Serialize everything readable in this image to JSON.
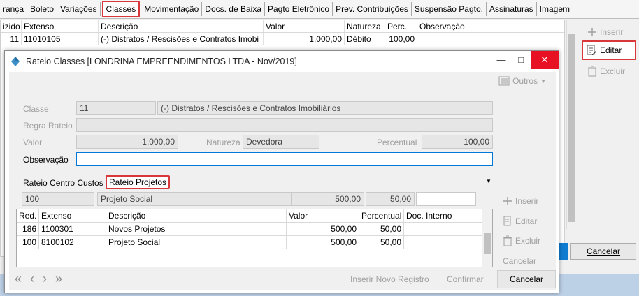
{
  "tabs": [
    "rança",
    "Boleto",
    "Variações",
    "Classes",
    "Movimentação",
    "Docs. de Baixa",
    "Pagto Eletrônico",
    "Prev. Contribuições",
    "Suspensão Pagto.",
    "Assinaturas",
    "Imagem"
  ],
  "main_grid": {
    "headers": [
      "izido",
      "Extenso",
      "Descrição",
      "Valor",
      "Natureza",
      "Perc.",
      "Observação"
    ],
    "row": [
      "11",
      "11010105",
      "(-) Distratos / Rescisões e Contratos Imobi",
      "1.000,00",
      "Débito",
      "100,00",
      ""
    ]
  },
  "main_buttons": {
    "inserir": "Inserir",
    "editar": "Editar",
    "excluir": "Excluir",
    "cancelar": "Cancelar"
  },
  "dialog": {
    "title": "Rateio Classes [LONDRINA EMPREENDIMENTOS LTDA - Nov/2019]",
    "outros": "Outros",
    "labels": {
      "classe": "Classe",
      "regra_rateio": "Regra Rateio",
      "valor": "Valor",
      "natureza": "Natureza",
      "percentual": "Percentual",
      "observacao": "Observação"
    },
    "values": {
      "classe_code": "11",
      "classe_desc": "(-) Distratos / Rescisões e Contratos Imobiliários",
      "regra_rateio": "",
      "valor": "1.000,00",
      "natureza": "Devedora",
      "percentual": "100,00",
      "observacao": ""
    },
    "subtabs": [
      "Rateio Centro Custos",
      "Rateio Projetos"
    ],
    "edit_row": [
      "100",
      "Projeto Social",
      "500,00",
      "50,00",
      ""
    ],
    "grid": {
      "headers": [
        "Red.",
        "Extenso",
        "Descrição",
        "Valor",
        "Percentual",
        "Doc. Interno"
      ],
      "rows": [
        [
          "186",
          "1100301",
          "Novos Projetos",
          "500,00",
          "50,00",
          ""
        ],
        [
          "100",
          "8100102",
          "Projeto Social",
          "500,00",
          "50,00",
          ""
        ]
      ]
    },
    "side_buttons": [
      "Inserir",
      "Editar",
      "Excluir",
      "Cancelar"
    ],
    "bottom": {
      "inserir_novo": "Inserir Novo Registro",
      "confirmar": "Confirmar",
      "cancelar": "Cancelar"
    }
  }
}
